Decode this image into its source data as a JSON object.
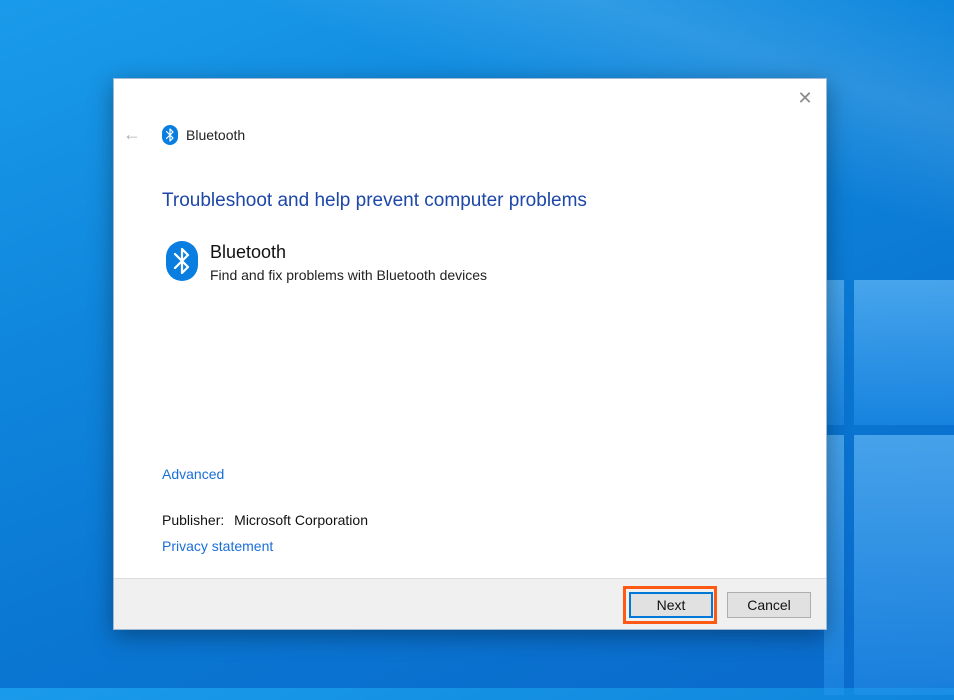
{
  "desktop": {
    "background_color": "#0f86dc"
  },
  "dialog": {
    "header": {
      "title": "Bluetooth",
      "icon": "bluetooth-icon"
    },
    "heading": "Troubleshoot and help prevent computer problems",
    "troubleshooter": {
      "title": "Bluetooth",
      "description": "Find and fix problems with Bluetooth devices",
      "icon": "bluetooth-icon"
    },
    "advanced_link": "Advanced",
    "publisher": {
      "label": "Publisher:",
      "value": "Microsoft Corporation"
    },
    "privacy_link": "Privacy statement",
    "buttons": {
      "next": "Next",
      "cancel": "Cancel"
    },
    "colors": {
      "heading": "#1d47a8",
      "link": "#1a6ed8",
      "bluetooth": "#0a7ee0",
      "highlight": "#ff5a14"
    }
  }
}
